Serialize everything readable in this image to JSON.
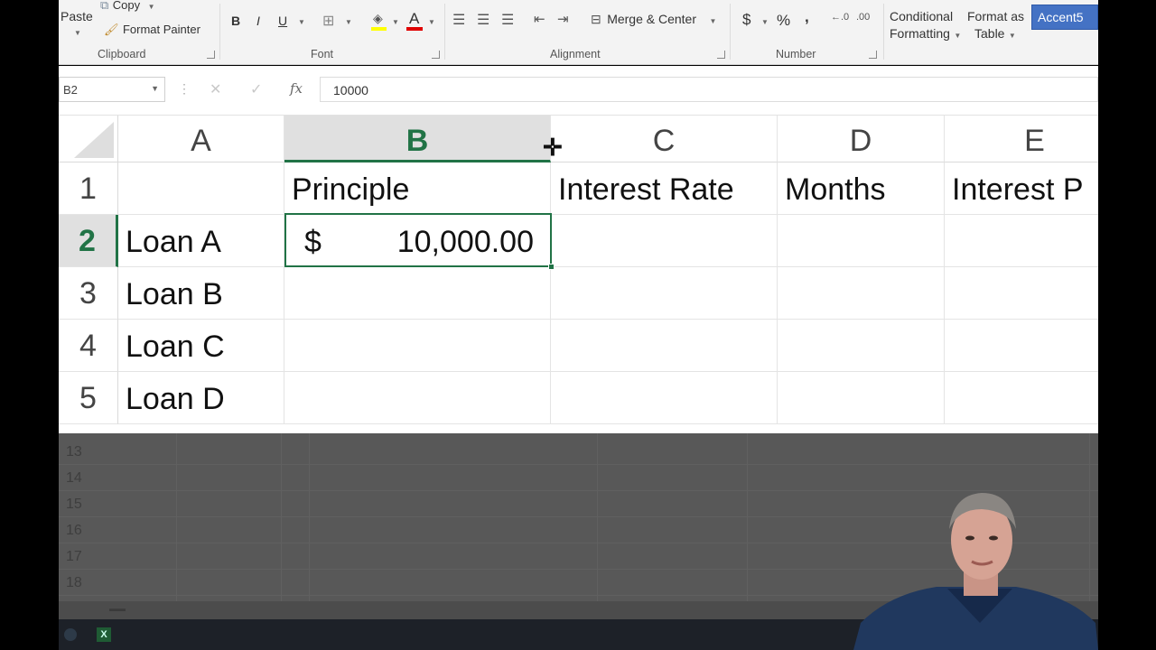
{
  "ribbon": {
    "clipboard": {
      "paste": "Paste",
      "copy": "Copy",
      "format_painter": "Format Painter",
      "label": "Clipboard"
    },
    "font": {
      "bold": "B",
      "italic": "I",
      "underline": "U",
      "font_color_glyph": "A",
      "label": "Font"
    },
    "alignment": {
      "merge_center": "Merge & Center",
      "label": "Alignment"
    },
    "number": {
      "currency": "$",
      "percent": "%",
      "comma": ",",
      "label": "Number"
    },
    "styles": {
      "conditional_line1": "Conditional",
      "conditional_line2": "Formatting",
      "format_table_line1": "Format as",
      "format_table_line2": "Table",
      "cell_style": "Accent5"
    }
  },
  "formula_bar": {
    "name_box": "B2",
    "fx": "fx",
    "value": "10000"
  },
  "sheet": {
    "columns": [
      {
        "label": "A",
        "selected": false
      },
      {
        "label": "B",
        "selected": true
      },
      {
        "label": "C",
        "selected": false
      },
      {
        "label": "D",
        "selected": false
      },
      {
        "label": "E",
        "selected": false
      }
    ],
    "rows": [
      {
        "num": "1",
        "selected": false,
        "cells": [
          "",
          "Principle",
          "Interest Rate",
          "Months",
          "Interest P"
        ]
      },
      {
        "num": "2",
        "selected": true,
        "cells": [
          "Loan A",
          "",
          "",
          "",
          ""
        ]
      },
      {
        "num": "3",
        "selected": false,
        "cells": [
          "Loan B",
          "",
          "",
          "",
          ""
        ]
      },
      {
        "num": "4",
        "selected": false,
        "cells": [
          "Loan C",
          "",
          "",
          "",
          ""
        ]
      },
      {
        "num": "5",
        "selected": false,
        "cells": [
          "Loan D",
          "",
          "",
          "",
          ""
        ]
      }
    ],
    "active_cell": {
      "ref": "B2",
      "currency_symbol": "$",
      "display_value": "10,000.00"
    },
    "dimmed_rows": [
      "13",
      "14",
      "15",
      "16",
      "17",
      "18"
    ]
  },
  "colors": {
    "excel_green": "#217346",
    "accent5": "#4472c4",
    "font_color_bar": "#e00000",
    "highlight_bar": "#ffff00"
  }
}
